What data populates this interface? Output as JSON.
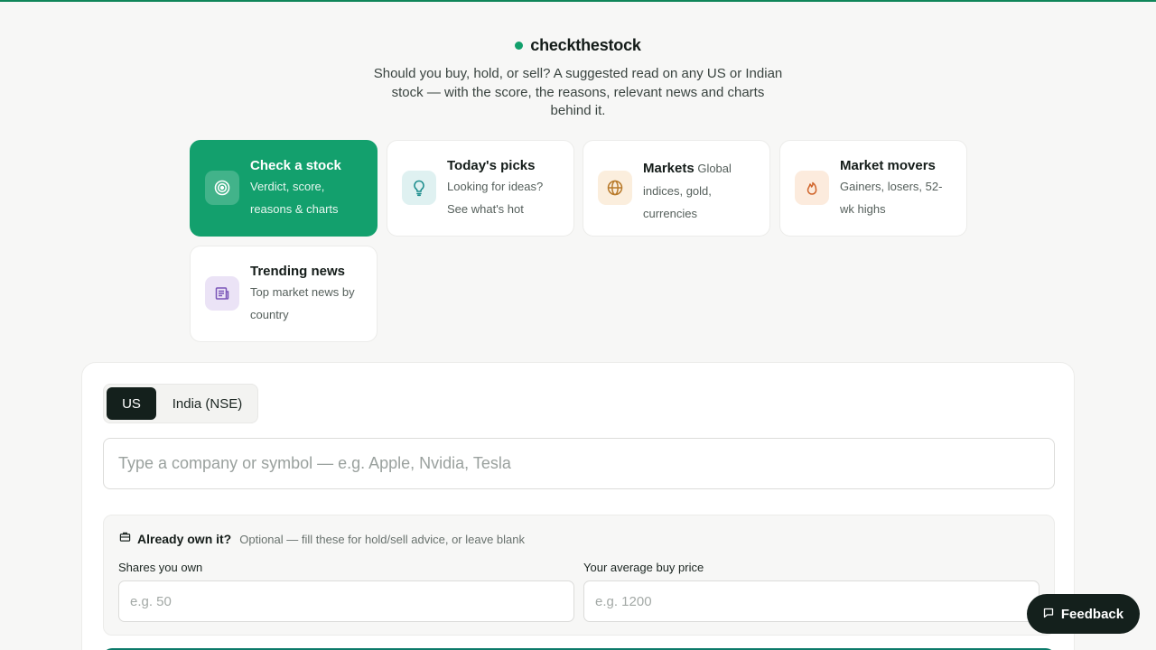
{
  "brand": {
    "name": "checkthestock",
    "accent": "#12a06c"
  },
  "tagline": "Should you buy, hold, or sell? A suggested read on any US or Indian stock — with the score, the reasons, relevant news and charts behind it.",
  "cards": [
    {
      "title": "Check a stock",
      "desc": "Verdict, score, reasons & charts",
      "icon": "target-icon",
      "active": true
    },
    {
      "title": "Today's picks",
      "desc": "Looking for ideas? See what's hot",
      "icon": "lightbulb-icon",
      "active": false
    },
    {
      "title": "Markets",
      "desc": "Global indices, gold, currencies",
      "icon": "globe-icon",
      "active": false
    },
    {
      "title": "Market movers",
      "desc": "Gainers, losers, 52-wk highs",
      "icon": "flame-icon",
      "active": false
    },
    {
      "title": "Trending news",
      "desc": "Top market news by country",
      "icon": "newspaper-icon",
      "active": false
    }
  ],
  "market_toggle": {
    "us": "US",
    "india": "India (NSE)",
    "selected": "US"
  },
  "search": {
    "placeholder": "Type a company or symbol — e.g. Apple, Nvidia, Tesla",
    "value": ""
  },
  "ownership": {
    "title": "Already own it?",
    "subtitle": "Optional — fill these for hold/sell advice, or leave blank",
    "shares_label": "Shares you own",
    "shares_placeholder": "e.g. 50",
    "price_label": "Your average buy price",
    "price_placeholder": "e.g. 1200"
  },
  "feedback": {
    "label": "Feedback"
  }
}
